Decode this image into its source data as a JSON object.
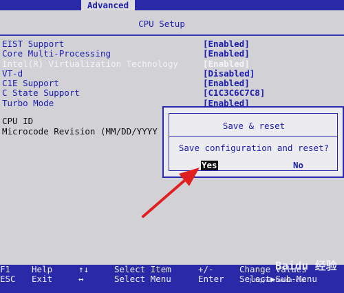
{
  "tabs": {
    "active": "Advanced"
  },
  "section": {
    "title": "CPU Setup"
  },
  "settings": [
    {
      "label": "EIST Support",
      "value": "[Enabled]"
    },
    {
      "label": "Core Multi-Processing",
      "value": "[Enabled]"
    },
    {
      "label": "Intel(R) Virtualization Technology",
      "value": "[Enabled]"
    },
    {
      "label": "VT-d",
      "value": "[Disabled]"
    },
    {
      "label": "C1E Support",
      "value": "[Enabled]"
    },
    {
      "label": "C State Support",
      "value": "[C1C3C6C7C8]"
    },
    {
      "label": "Turbo Mode",
      "value": "[Enabled]"
    }
  ],
  "info": [
    {
      "label": "CPU ID"
    },
    {
      "label": "Microcode Revision (MM/DD/YYYY"
    }
  ],
  "dialog": {
    "title": "Save & reset",
    "message": "Save configuration and reset?",
    "yes": "Yes",
    "no": "No"
  },
  "footer": {
    "k1": "F1",
    "k1_label": "Help",
    "k2": "ESC",
    "k2_label": "Exit",
    "k3": "↑↓",
    "k3_label": "Select Item",
    "k4": "↔",
    "k4_label": "Select Menu",
    "k5": "+/-",
    "k5_label": "Change Values",
    "k6": "Enter",
    "k6_label": "Select▶Sub-Menu"
  },
  "colors": {
    "accent": "#2a2aa8",
    "text": "#1b1bb0",
    "annotation": "#e02020"
  },
  "watermark": {
    "text": "Baidu 经验",
    "sub": "jingyan.baidu.com"
  }
}
